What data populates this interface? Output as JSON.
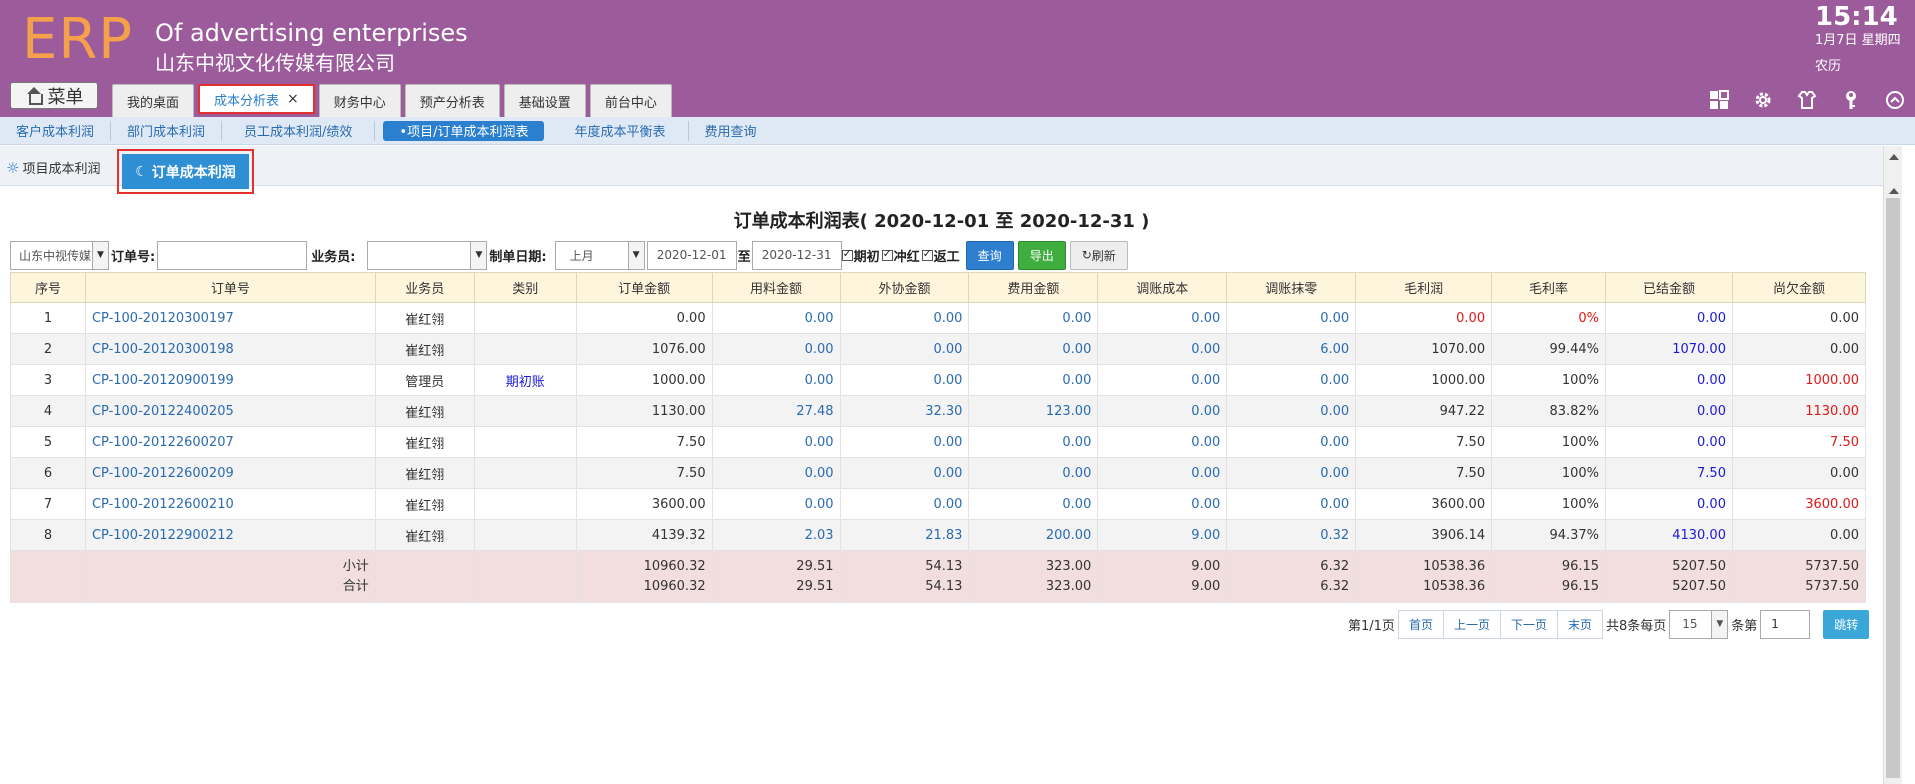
{
  "header": {
    "logo": "ERP",
    "tagline": "Of advertising enterprises",
    "company": "山东中视文化传媒有限公司",
    "time": "15:14",
    "date": "1月7日 星期四",
    "lunar": "农历",
    "bg_color": "#9c5c9c",
    "logo_color": "#f5a04a"
  },
  "menu": {
    "label": "菜单",
    "icon": "home-icon"
  },
  "top_tabs": [
    {
      "label": "我的桌面"
    },
    {
      "label": "成本分析表",
      "active": true,
      "close": "×"
    },
    {
      "label": "财务中心"
    },
    {
      "label": "预产分析表"
    },
    {
      "label": "基础设置"
    },
    {
      "label": "前台中心"
    }
  ],
  "tool_icons": [
    "grid-icon",
    "gear-icon",
    "shirt-icon",
    "key-icon",
    "collapse-up-icon"
  ],
  "subnav": [
    {
      "label": "客户成本利润"
    },
    {
      "label": "部门成本利润"
    },
    {
      "label": "员工成本利润/绩效"
    },
    {
      "label": "•项目/订单成本利润表",
      "active": true
    },
    {
      "label": "年度成本平衡表"
    },
    {
      "label": "费用查询"
    }
  ],
  "thirdnav": {
    "items": [
      {
        "label": "项目成本利润",
        "icon": "sun-icon"
      },
      {
        "label": "订单成本利润",
        "icon": "moon-icon",
        "active": true
      }
    ]
  },
  "report": {
    "title": "订单成本利润表( 2020-12-01 至 2020-12-31 )"
  },
  "filters": {
    "company_select": "山东中视传媒",
    "order_no_label": "订单号:",
    "order_no_value": "",
    "salesman_label": "业务员:",
    "salesman_value": "",
    "date_label": "制单日期:",
    "period_select": "上月",
    "date_from": "2020-12-01",
    "to_label": "至",
    "date_to": "2020-12-31",
    "checks": [
      {
        "label": "期初"
      },
      {
        "label": "冲红"
      },
      {
        "label": "返工"
      }
    ],
    "query_btn": "查询",
    "export_btn": "导出",
    "refresh_btn": "刷新"
  },
  "table": {
    "columns": [
      "序号",
      "订单号",
      "业务员",
      "类别",
      "订单金额",
      "用料金额",
      "外协金额",
      "费用金额",
      "调账成本",
      "调账抹零",
      "毛利润",
      "毛利率",
      "已结金额",
      "尚欠金额"
    ],
    "rows": [
      {
        "no": "1",
        "order": "CP-100-20120300197",
        "salesman": "崔红翎",
        "type": "",
        "amount": "0.00",
        "material": "0.00",
        "outsource": "0.00",
        "expense": "0.00",
        "adj_cost": "0.00",
        "adj_round": "0.00",
        "gross": "0.00",
        "rate": "0%",
        "settled": "0.00",
        "owed": "0.00",
        "gross_red": true,
        "rate_red": true,
        "owed_red": false
      },
      {
        "no": "2",
        "order": "CP-100-20120300198",
        "salesman": "崔红翎",
        "type": "",
        "amount": "1076.00",
        "material": "0.00",
        "outsource": "0.00",
        "expense": "0.00",
        "adj_cost": "0.00",
        "adj_round": "6.00",
        "gross": "1070.00",
        "rate": "99.44%",
        "settled": "1070.00",
        "owed": "0.00",
        "gross_red": false,
        "rate_red": false,
        "owed_red": false
      },
      {
        "no": "3",
        "order": "CP-100-20120900199",
        "salesman": "管理员",
        "type": "期初账",
        "amount": "1000.00",
        "material": "0.00",
        "outsource": "0.00",
        "expense": "0.00",
        "adj_cost": "0.00",
        "adj_round": "0.00",
        "gross": "1000.00",
        "rate": "100%",
        "settled": "0.00",
        "owed": "1000.00",
        "gross_red": false,
        "rate_red": false,
        "owed_red": true
      },
      {
        "no": "4",
        "order": "CP-100-20122400205",
        "salesman": "崔红翎",
        "type": "",
        "amount": "1130.00",
        "material": "27.48",
        "outsource": "32.30",
        "expense": "123.00",
        "adj_cost": "0.00",
        "adj_round": "0.00",
        "gross": "947.22",
        "rate": "83.82%",
        "settled": "0.00",
        "owed": "1130.00",
        "gross_red": false,
        "rate_red": false,
        "owed_red": true
      },
      {
        "no": "5",
        "order": "CP-100-20122600207",
        "salesman": "崔红翎",
        "type": "",
        "amount": "7.50",
        "material": "0.00",
        "outsource": "0.00",
        "expense": "0.00",
        "adj_cost": "0.00",
        "adj_round": "0.00",
        "gross": "7.50",
        "rate": "100%",
        "settled": "0.00",
        "owed": "7.50",
        "gross_red": false,
        "rate_red": false,
        "owed_red": true
      },
      {
        "no": "6",
        "order": "CP-100-20122600209",
        "salesman": "崔红翎",
        "type": "",
        "amount": "7.50",
        "material": "0.00",
        "outsource": "0.00",
        "expense": "0.00",
        "adj_cost": "0.00",
        "adj_round": "0.00",
        "gross": "7.50",
        "rate": "100%",
        "settled": "7.50",
        "owed": "0.00",
        "gross_red": false,
        "rate_red": false,
        "owed_red": false
      },
      {
        "no": "7",
        "order": "CP-100-20122600210",
        "salesman": "崔红翎",
        "type": "",
        "amount": "3600.00",
        "material": "0.00",
        "outsource": "0.00",
        "expense": "0.00",
        "adj_cost": "0.00",
        "adj_round": "0.00",
        "gross": "3600.00",
        "rate": "100%",
        "settled": "0.00",
        "owed": "3600.00",
        "gross_red": false,
        "rate_red": false,
        "owed_red": true
      },
      {
        "no": "8",
        "order": "CP-100-20122900212",
        "salesman": "崔红翎",
        "type": "",
        "amount": "4139.32",
        "material": "2.03",
        "outsource": "21.83",
        "expense": "200.00",
        "adj_cost": "9.00",
        "adj_round": "0.32",
        "gross": "3906.14",
        "rate": "94.37%",
        "settled": "4130.00",
        "owed": "0.00",
        "gross_red": false,
        "rate_red": false,
        "owed_red": false
      }
    ],
    "subtotal": {
      "label": "小计",
      "amount": "10960.32",
      "material": "29.51",
      "outsource": "54.13",
      "expense": "323.00",
      "adj_cost": "9.00",
      "adj_round": "6.32",
      "gross": "10538.36",
      "rate": "96.15",
      "settled": "5207.50",
      "owed": "5737.50"
    },
    "total": {
      "label": "合计",
      "amount": "10960.32",
      "material": "29.51",
      "outsource": "54.13",
      "expense": "323.00",
      "adj_cost": "9.00",
      "adj_round": "6.32",
      "gross": "10538.36",
      "rate": "96.15",
      "settled": "5207.50",
      "owed": "5737.50"
    }
  },
  "pager": {
    "page_info": "第1/1页",
    "first": "首页",
    "prev": "上一页",
    "next": "下一页",
    "last": "末页",
    "total_text": "共8条每页",
    "page_size": "15",
    "per_page_suffix": "条第",
    "page_input": "1",
    "go_btn": "跳转"
  }
}
